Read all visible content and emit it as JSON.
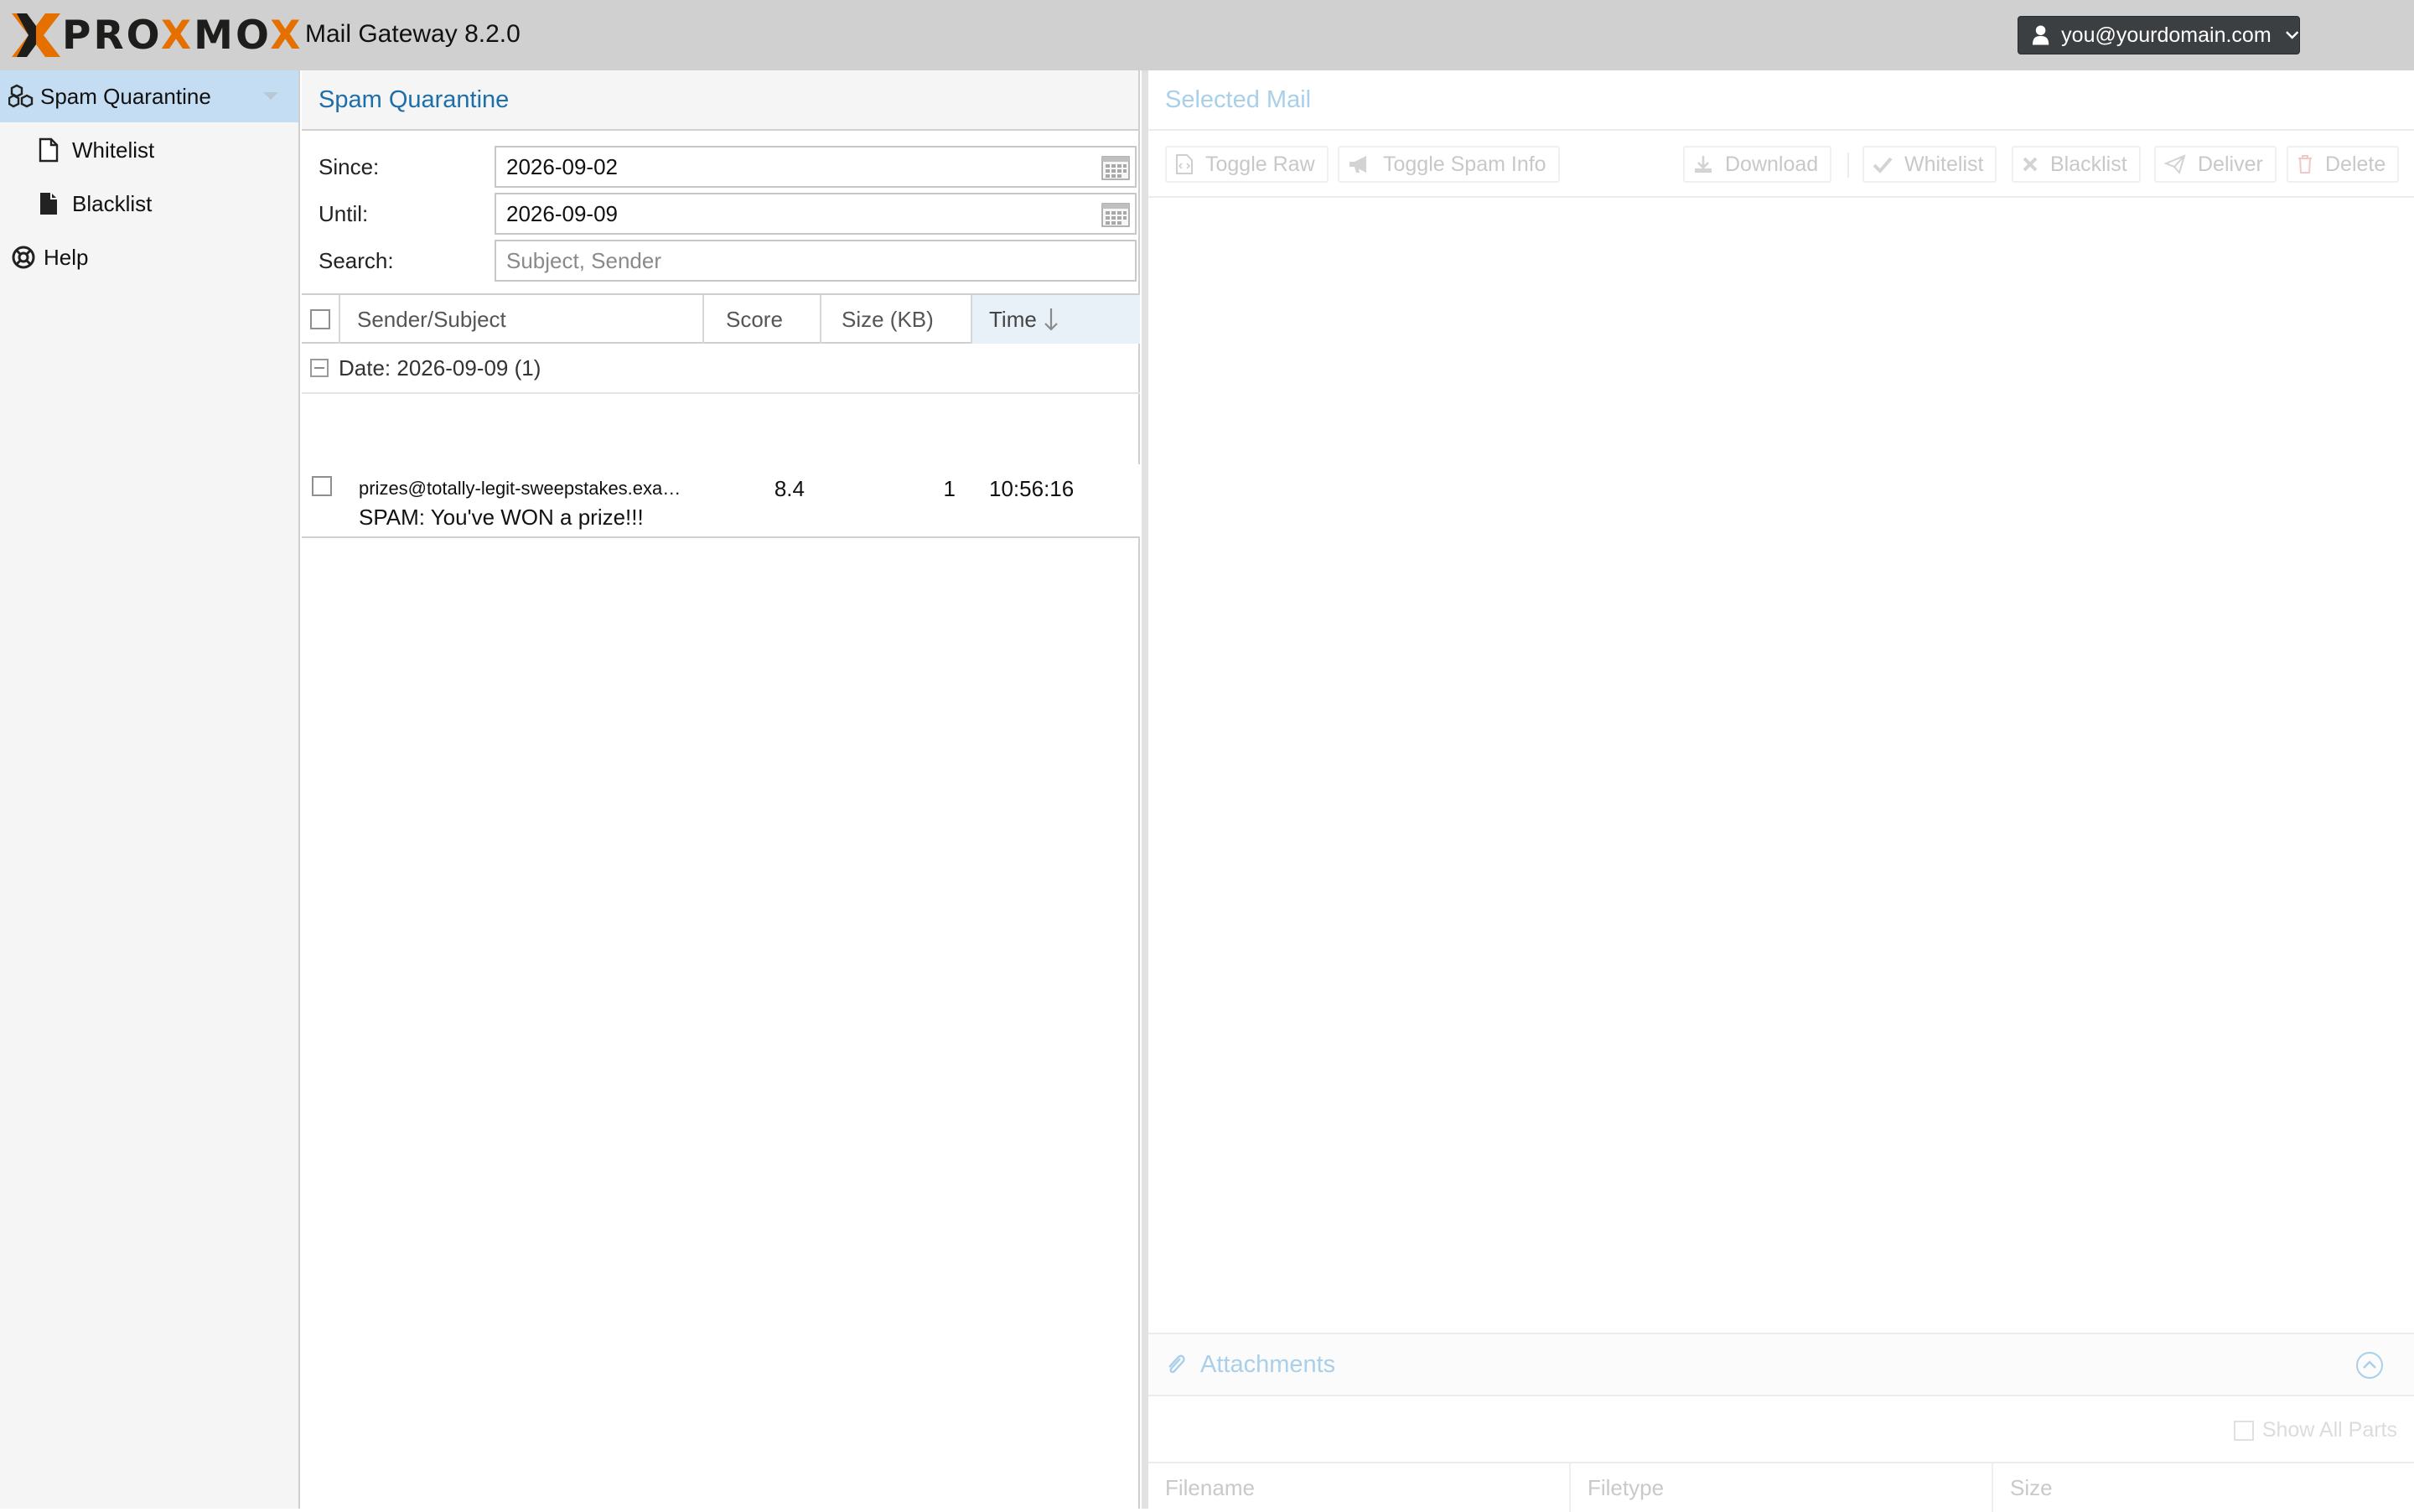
{
  "header": {
    "logo_text_left": "PRO",
    "logo_x": "X",
    "logo_text_right": "MO",
    "product": "Mail Gateway 8.2.0",
    "user": "you@yourdomain.com",
    "user_icon": "user-icon",
    "accent_color": "#e57000"
  },
  "sidebar": {
    "items": [
      {
        "label": "Spam Quarantine",
        "icon": "cubes-icon",
        "active": true
      },
      {
        "label": "Whitelist",
        "icon": "file-outline-icon"
      },
      {
        "label": "Blacklist",
        "icon": "file-solid-icon"
      },
      {
        "label": "Help",
        "icon": "life-ring-icon"
      }
    ]
  },
  "quarantine": {
    "title": "Spam Quarantine",
    "since_label": "Since:",
    "since_value": "2026-09-02",
    "until_label": "Until:",
    "until_value": "2026-09-09",
    "search_label": "Search:",
    "search_placeholder": "Subject, Sender",
    "columns": {
      "sender_subject": "Sender/Subject",
      "score": "Score",
      "size": "Size (KB)",
      "time": "Time"
    },
    "group_label": "Date: 2026-09-09 (1)",
    "rows": [
      {
        "sender": "prizes@totally-legit-sweepstakes.exa…",
        "subject": "SPAM: You've WON a prize!!!",
        "score": "8.4",
        "size": "1",
        "time": "10:56:16"
      }
    ]
  },
  "selected_mail": {
    "title": "Selected Mail",
    "toolbar": {
      "toggle_raw": "Toggle Raw",
      "toggle_spam_info": "Toggle Spam Info",
      "download": "Download",
      "whitelist": "Whitelist",
      "blacklist": "Blacklist",
      "deliver": "Deliver",
      "delete": "Delete"
    }
  },
  "attachments": {
    "title": "Attachments",
    "show_all_parts": "Show All Parts",
    "columns": {
      "filename": "Filename",
      "filetype": "Filetype",
      "size": "Size"
    }
  }
}
